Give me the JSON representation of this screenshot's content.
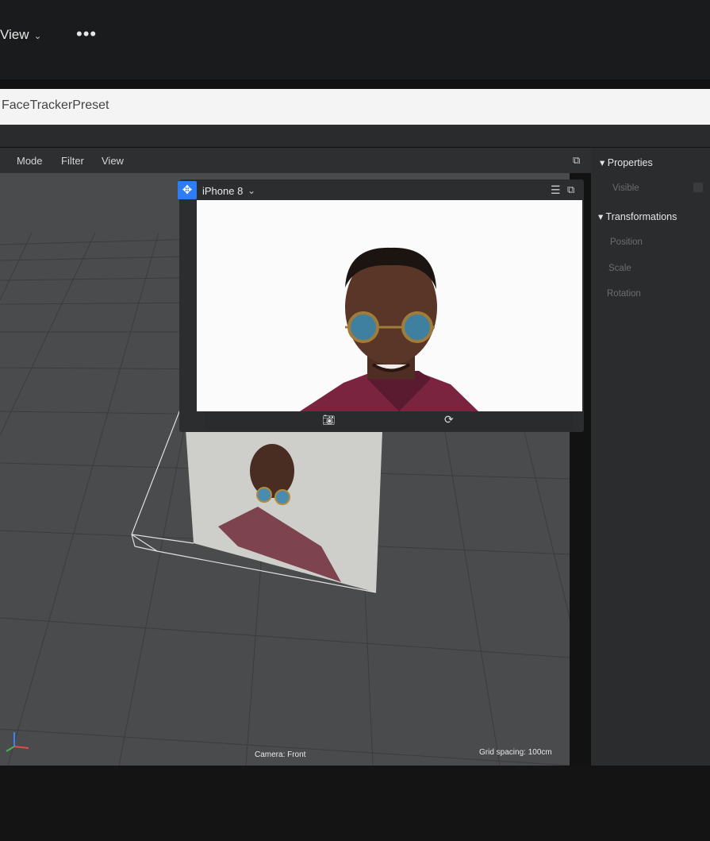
{
  "app": {
    "menu_view": "View",
    "more_label": "•••",
    "doc_title": "FaceTrackerPreset"
  },
  "viewport": {
    "menu": [
      "Mode",
      "Filter",
      "View"
    ],
    "camera_label": "Camera: Front",
    "grid_label": "Grid spacing: 100cm"
  },
  "simulator": {
    "device": "iPhone 8"
  },
  "properties": {
    "title": "Properties",
    "visible_label": "Visible",
    "transform_title": "Transformations",
    "position_label": "Position",
    "scale_label": "Scale",
    "rotation_label": "Rotation"
  },
  "colors": {
    "accent": "#2f7df6",
    "viewport_bg": "#4a4b4d",
    "panel_bg": "#2b2c2e"
  },
  "icons": [
    "chevron-down-icon",
    "more-icon",
    "move-icon",
    "hamburger-icon",
    "popout-icon",
    "camera-icon",
    "rotate-icon",
    "axis-icon"
  ]
}
